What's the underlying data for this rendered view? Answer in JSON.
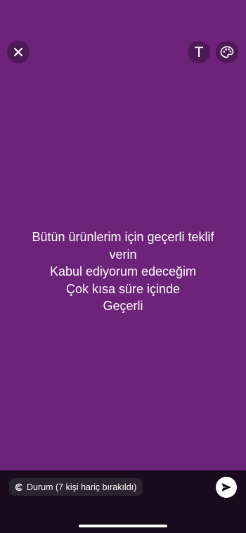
{
  "colors": {
    "background": "#6c2379",
    "bottom_bar": "#190a1d",
    "pill": "#2b2430",
    "text": "#ffffff"
  },
  "toolbar": {
    "close_icon": "close-icon",
    "text_tool_label": "T",
    "palette_icon": "palette-icon"
  },
  "status": {
    "lines": [
      "Bütün ürünlerim için geçerli teklif",
      "verin",
      "Kabul ediyorum edeceğim",
      "Çok kısa süre içinde",
      "Geçerli"
    ]
  },
  "footer": {
    "privacy_icon": "privacy-circle-icon",
    "privacy_label": "Durum (7 kişi hariç bırakıldı)",
    "send_icon": "send-icon"
  }
}
